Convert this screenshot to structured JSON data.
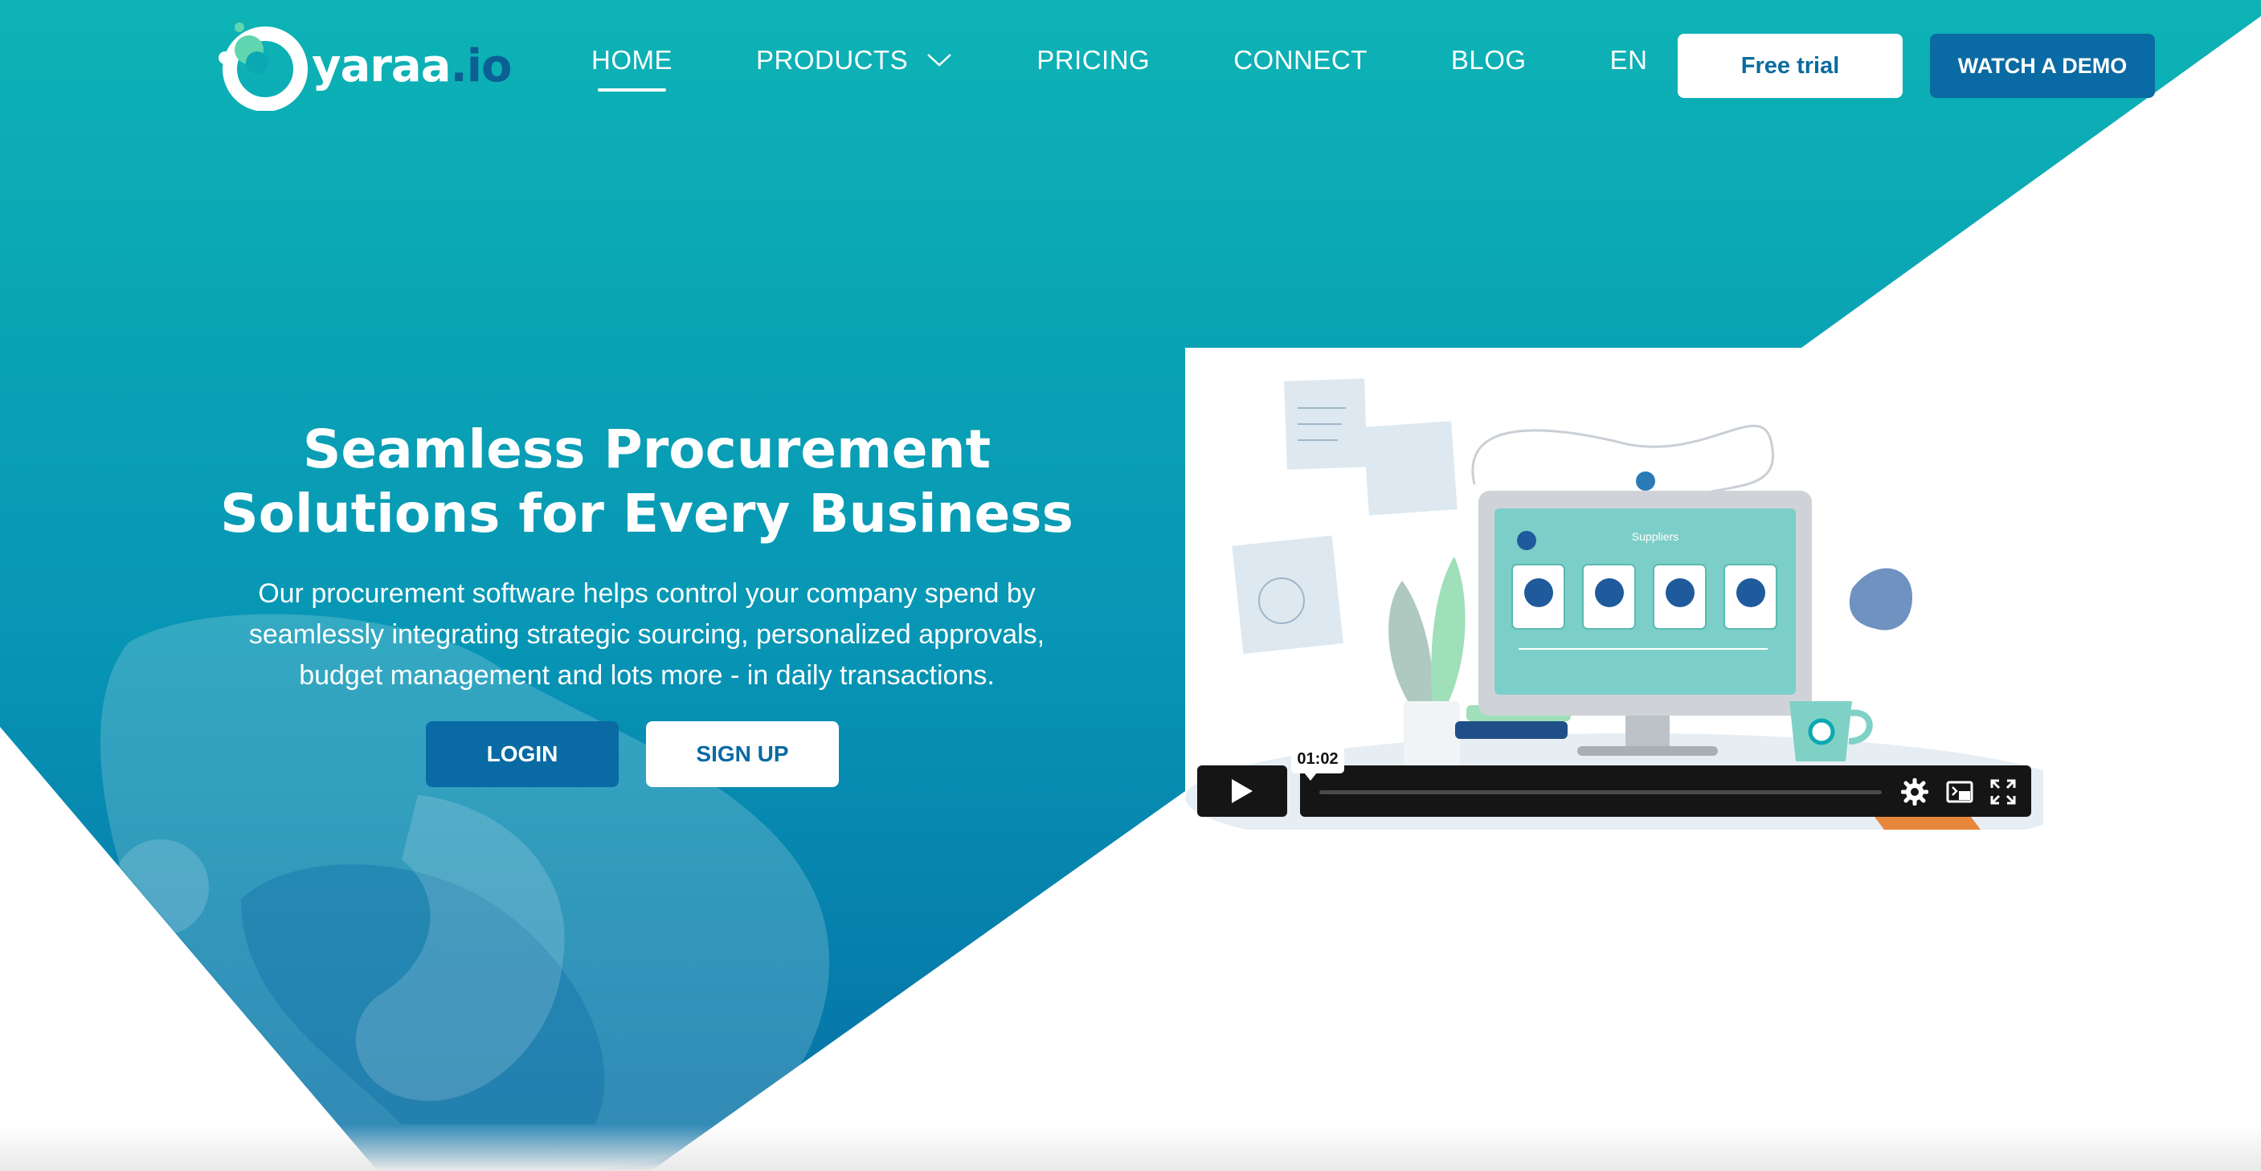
{
  "brand": {
    "name_main": "yaraa",
    "name_dot": ".io",
    "primary_color": "#0aa9b2",
    "dark_color": "#0a6aa3"
  },
  "nav": {
    "items": [
      {
        "label": "HOME",
        "active": true
      },
      {
        "label": "PRODUCTS",
        "has_dropdown": true
      },
      {
        "label": "PRICING"
      },
      {
        "label": "CONNECT"
      },
      {
        "label": "BLOG"
      },
      {
        "label": "EN"
      }
    ],
    "free_trial_label": "Free trial",
    "watch_demo_label": "WATCH A DEMO"
  },
  "hero": {
    "title_line1": "Seamless Procurement",
    "title_line2": "Solutions for Every Business",
    "subtitle_line1": "Our procurement software helps control your company spend by",
    "subtitle_line2": "seamlessly integrating strategic sourcing, personalized approvals,",
    "subtitle_line3": "budget management and lots more - in daily transactions.",
    "login_label": "LOGIN",
    "signup_label": "SIGN UP"
  },
  "video": {
    "screen_title": "Suppliers",
    "time_tooltip": "01:02",
    "icons": [
      "play-icon",
      "gear-icon",
      "picture-in-picture-icon",
      "fullscreen-icon"
    ]
  }
}
